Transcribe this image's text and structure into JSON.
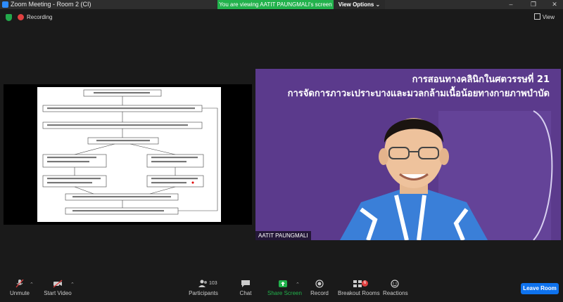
{
  "window": {
    "title": "Zoom Meeting - Room 2 (CI)",
    "minimize": "–",
    "restore": "❐",
    "close": "✕"
  },
  "share_banner": {
    "viewing_text": "You are viewing AATIT PAUNGMALI's screen",
    "view_options": "View Options ⌄"
  },
  "status": {
    "recording": "Recording",
    "view": "View"
  },
  "slide": {
    "title_line1": "การสอนทางคลินิกในศตวรรษที่ 21",
    "title_line2": "การจัดการภาวะเปราะบางและมวลกล้ามเนื้อน้อยทางกายภาพบำบัด"
  },
  "participant": {
    "name": "AATIT PAUNGMALI"
  },
  "toolbar": {
    "unmute": "Unmute",
    "start_video": "Start Video",
    "participants": "Participants",
    "participants_count": "103",
    "chat": "Chat",
    "share_screen": "Share Screen",
    "record": "Record",
    "breakout_rooms": "Breakout Rooms",
    "breakout_badge": "6",
    "reactions": "Reactions",
    "leave": "Leave Room"
  },
  "colors": {
    "share_green": "#22b24c",
    "leave_blue": "#0e72ed",
    "slide_purple": "#5b3a8c",
    "record_red": "#e04040"
  }
}
